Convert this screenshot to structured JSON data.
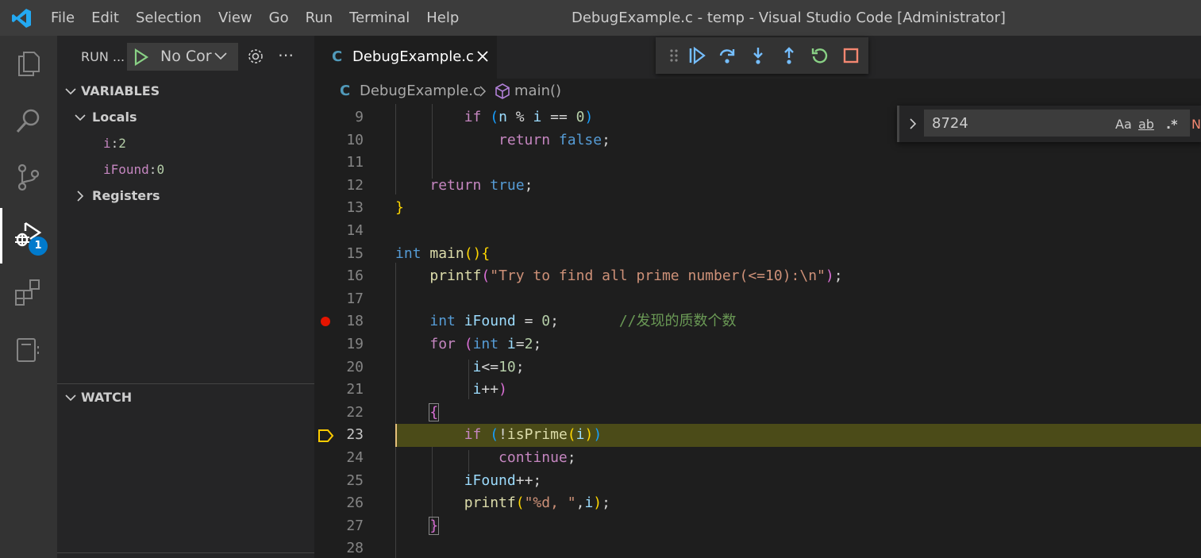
{
  "titlebar": {
    "menu": [
      "File",
      "Edit",
      "Selection",
      "View",
      "Go",
      "Run",
      "Terminal",
      "Help"
    ],
    "window_title": "DebugExample.c - temp - Visual Studio Code [Administrator]"
  },
  "activity": {
    "debug_badge": "1"
  },
  "sidebar": {
    "run_label": "RUN ...",
    "config_name": "No Cor",
    "variables_header": "VARIABLES",
    "locals_label": "Locals",
    "locals": [
      {
        "name": "i",
        "value": "2"
      },
      {
        "name": "iFound",
        "value": "0"
      }
    ],
    "registers_label": "Registers",
    "watch_header": "WATCH"
  },
  "tab": {
    "file_icon": "C",
    "name": "DebugExample.c"
  },
  "breadcrumb": {
    "file_icon": "C",
    "file": "DebugExample.c",
    "symbol": "main()"
  },
  "find": {
    "value": "8724",
    "match_case": "Aa",
    "whole_word": "ab",
    "regex": ".*",
    "no_results": "N"
  },
  "editor": {
    "line_numbers": [
      "9",
      "10",
      "11",
      "12",
      "13",
      "14",
      "15",
      "16",
      "17",
      "18",
      "19",
      "20",
      "21",
      "22",
      "23",
      "24",
      "25",
      "26",
      "27",
      "28"
    ],
    "breakpoint_line": "18",
    "current_line": "23",
    "comment_text": "//发现的质数个数",
    "printf_string": "\"Try to find all prime number(<=10):\\n\"",
    "printf_fmt": "\"%d, \""
  },
  "colors": {
    "accent": "#007acc",
    "breakpoint": "#e51400",
    "current_line_bg": "#4b4b18"
  }
}
